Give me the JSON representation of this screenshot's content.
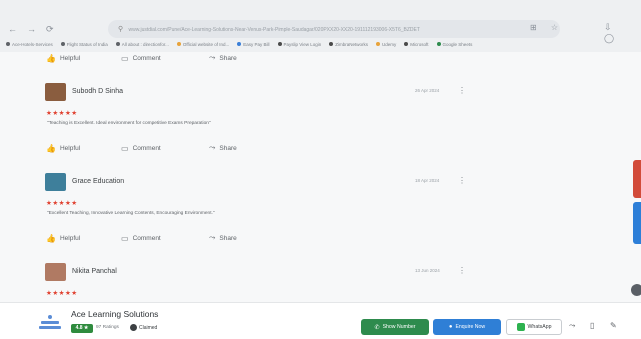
{
  "browser": {
    "nav_icons": [
      "←",
      "→",
      "⟳"
    ],
    "url": "www.justdial.com/Pune/Ace-Learning-Solutions-Near-Venus-Park-Pimple-Saudagar/020PXX20-XX20-191112193006-X5T6_BZDET",
    "address_icons": "⊞ ☆",
    "window_icons": "⇩ ◯",
    "bookmarks": [
      {
        "label": "Ace-Hotels-Services",
        "color": "#5f6368"
      },
      {
        "label": "Flight Status of India",
        "color": "#5f6368"
      },
      {
        "label": "All about : directionfor...",
        "color": "#5f6368"
      },
      {
        "label": "Official website of Ind...",
        "color": "#e8a33a"
      },
      {
        "label": "Easy Pay Bill",
        "color": "#3a7fd8"
      },
      {
        "label": "Payslip View Login",
        "color": "#4a4a4a"
      },
      {
        "label": "ZimbraNetworks",
        "color": "#4a4a4a"
      },
      {
        "label": "Udemy",
        "color": "#e8a33a"
      },
      {
        "label": "Microsoft",
        "color": "#4a4a4a"
      },
      {
        "label": "Google Sheets",
        "color": "#2e8b4d"
      }
    ]
  },
  "actions": {
    "helpful": "Helpful",
    "comment": "Comment",
    "share": "Share"
  },
  "reviews": [
    {
      "name": "Subodh D Sinha",
      "date": "26 Apr 2024",
      "stars": "★★★★★",
      "text": "\"Teaching is Excellent. Ideal environment for competitive Exams Preparation\"",
      "avatar_color": "#8a5d3f"
    },
    {
      "name": "Grace Education",
      "date": "18 Apr 2024",
      "stars": "★★★★★",
      "text": "\"Excellent Teaching, Innovative Learning Contents, Encouraging Environment.\"",
      "avatar_color": "#3e7f9b"
    },
    {
      "name": "Nikita Panchal",
      "date": "13 Jun 2024",
      "stars": "★★★★★",
      "text": "",
      "avatar_color": "#b07a63"
    }
  ],
  "business": {
    "name": "Ace Learning Solutions",
    "rating": "4.8 ★",
    "rating_count": "97 Ratings",
    "claimed": "Claimed"
  },
  "buttons": {
    "show_number": "Show Number",
    "enquire_now": "Enquire Now",
    "whatsapp": "WhatsApp"
  },
  "colors": {
    "star": "#e0402f",
    "green": "#2e8b4d",
    "blue": "#2f7fd6"
  }
}
